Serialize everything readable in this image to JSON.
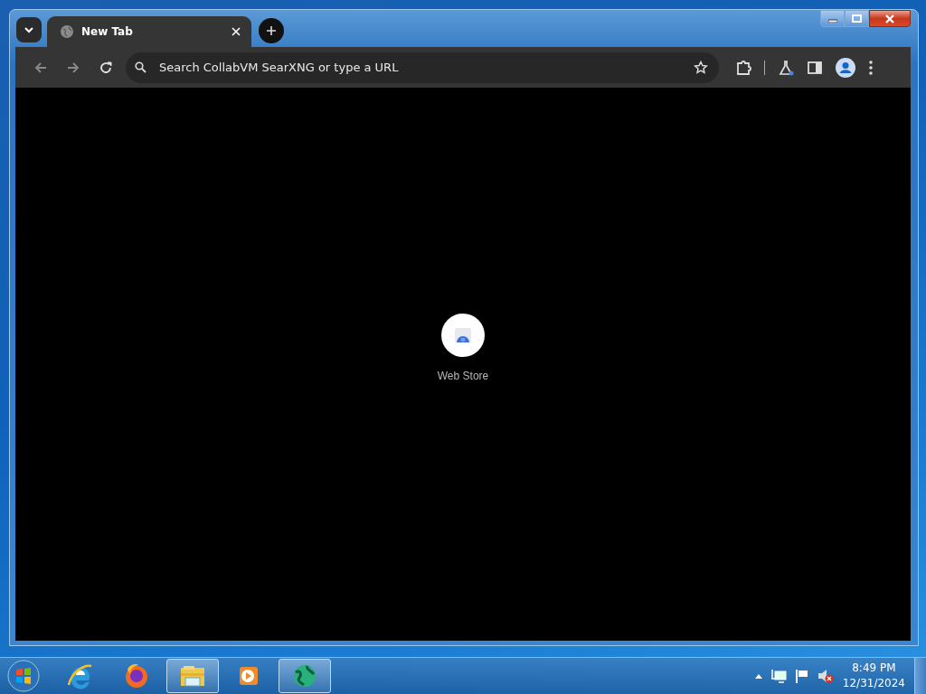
{
  "browser": {
    "tabs": [
      {
        "title": "New Tab",
        "selected": true
      }
    ],
    "omnibox": {
      "placeholder": "Search CollabVM SearXNG or type a URL"
    },
    "shortcuts": [
      {
        "label": "Web Store"
      }
    ]
  },
  "taskbar": {
    "apps": [
      {
        "kind": "ie",
        "active": false
      },
      {
        "kind": "firefox",
        "active": false
      },
      {
        "kind": "explorer",
        "active": true
      },
      {
        "kind": "media",
        "active": false
      },
      {
        "kind": "globe",
        "active": true
      }
    ],
    "clock": {
      "time": "8:49 PM",
      "date": "12/31/2024"
    }
  }
}
